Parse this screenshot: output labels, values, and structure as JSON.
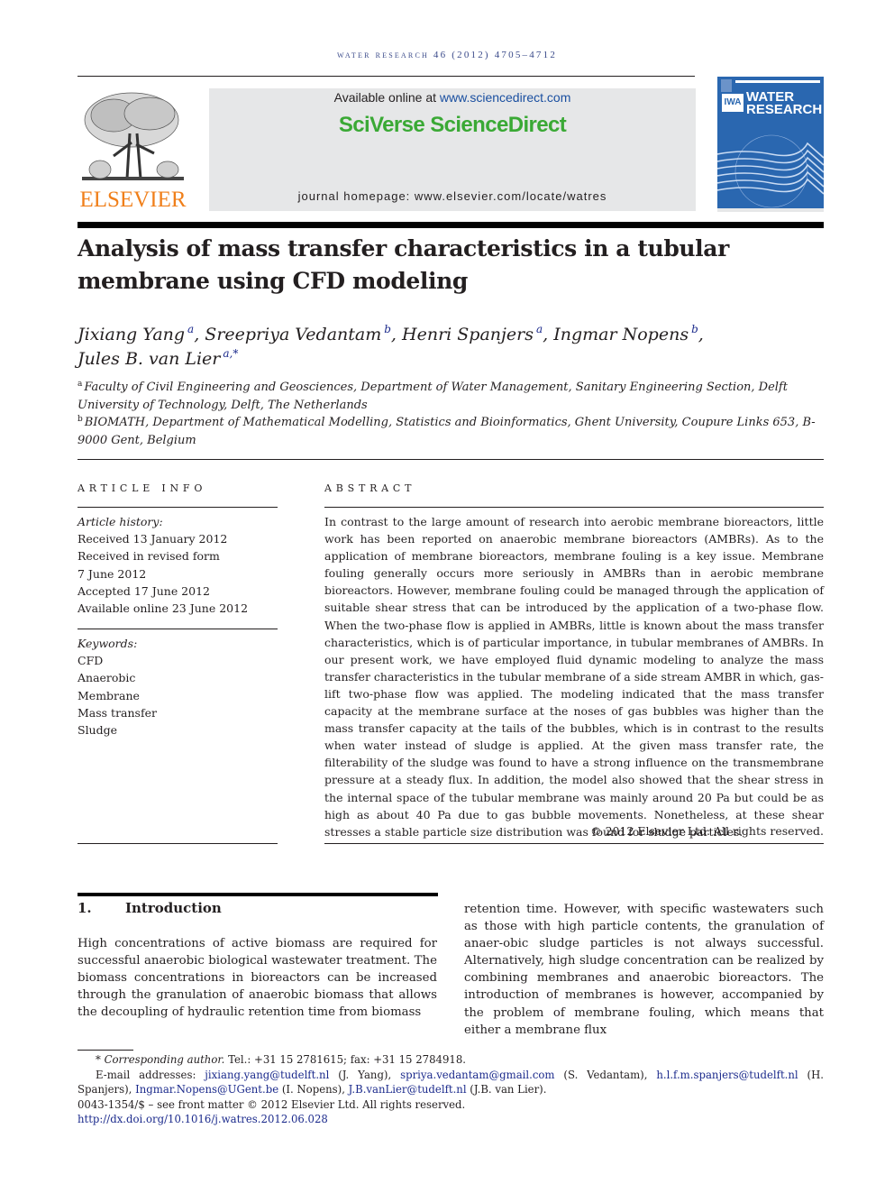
{
  "running_head": "WATER RESEARCH 46 (2012) 4705–4712",
  "header": {
    "publisher_name": "ELSEVIER",
    "available_online_prefix": "Available online at ",
    "available_online_link": "www.sciencedirect.com",
    "brand": "SciVerse ScienceDirect",
    "journal_homepage": "journal homepage: www.elsevier.com/locate/watres",
    "cover": {
      "badge": "IWA",
      "title_line1": "WATER",
      "title_line2": "RESEARCH",
      "color": "#2a67b0"
    }
  },
  "article": {
    "title": "Analysis of mass transfer characteristics in a tubular membrane using CFD modeling",
    "authors": [
      {
        "name": "Jixiang Yang",
        "sup": "a",
        "sep": ", "
      },
      {
        "name": "Sreepriya Vedantam",
        "sup": "b",
        "sep": ", "
      },
      {
        "name": "Henri Spanjers",
        "sup": "a",
        "sep": ", "
      },
      {
        "name": "Ingmar Nopens",
        "sup": "b",
        "sep": ","
      },
      {
        "name": "Jules B. van Lier",
        "sup": "a,*",
        "sep": ""
      }
    ],
    "affiliations": [
      {
        "mark": "a",
        "text": "Faculty of Civil Engineering and Geosciences, Department of Water Management, Sanitary Engineering Section, Delft University of Technology, Delft, The Netherlands"
      },
      {
        "mark": "b",
        "text": "BIOMATH, Department of Mathematical Modelling, Statistics and Bioinformatics, Ghent University, Coupure Links 653, B-9000 Gent, Belgium"
      }
    ]
  },
  "article_info": {
    "label": "ARTICLE INFO",
    "history_label": "Article history:",
    "history": [
      "Received 13 January 2012",
      "Received in revised form",
      "7 June 2012",
      "Accepted 17 June 2012",
      "Available online 23 June 2012"
    ],
    "keywords_label": "Keywords:",
    "keywords": [
      "CFD",
      "Anaerobic",
      "Membrane",
      "Mass transfer",
      "Sludge"
    ]
  },
  "abstract": {
    "label": "ABSTRACT",
    "text": "In contrast to the large amount of research into aerobic membrane bioreactors, little work has been reported on anaerobic membrane bioreactors (AMBRs). As to the application of membrane bioreactors, membrane fouling is a key issue. Membrane fouling generally occurs more seriously in AMBRs than in aerobic membrane bioreactors. However, membrane fouling could be managed through the application of suitable shear stress that can be introduced by the application of a two-phase flow. When the two-phase flow is applied in AMBRs, little is known about the mass transfer characteristics, which is of particular importance, in tubular membranes of AMBRs. In our present work, we have employed fluid dynamic modeling to analyze the mass transfer characteristics in the tubular membrane of a side stream AMBR in which, gas-lift two-phase flow was applied. The modeling indicated that the mass transfer capacity at the membrane surface at the noses of gas bubbles was higher than the mass transfer capacity at the tails of the bubbles, which is in contrast to the results when water instead of sludge is applied. At the given mass transfer rate, the filterability of the sludge was found to have a strong influence on the transmembrane pressure at a steady flux. In addition, the model also showed that the shear stress in the internal space of the tubular membrane was mainly around 20 Pa but could be as high as about 40 Pa due to gas bubble movements. Nonetheless, at these shear stresses a stable particle size distribution was found for sludge particles.",
    "copyright": "© 2012 Elsevier Ltd. All rights reserved."
  },
  "introduction": {
    "number": "1.",
    "heading": "Introduction",
    "left_column": "High concentrations of active biomass are required for successful anaerobic biological wastewater treatment. The biomass concentrations in bioreactors can be increased through the granulation of anaerobic biomass that allows the decoupling of hydraulic retention time from biomass",
    "right_column": "retention time. However, with specific wastewaters such as those with high particle contents, the granulation of anaer-obic sludge particles is not always successful. Alternatively, high sludge concentration can be realized by combining membranes and anaerobic bioreactors. The introduction of membranes is however, accompanied by the problem of membrane fouling, which means that either a membrane flux"
  },
  "footnotes": {
    "corresponding_mark": "*",
    "corresponding_label": "Corresponding author.",
    "corresponding_contact": " Tel.: +31 15 2781615; fax: +31 15 2784918.",
    "email_label": "E-mail addresses: ",
    "emails": [
      {
        "email": "jixiang.yang@tudelft.nl",
        "owner": " (J. Yang), "
      },
      {
        "email": "spriya.vedantam@gmail.com",
        "owner": " (S. Vedantam), "
      },
      {
        "email": "h.l.f.m.spanjers@tudelft.nl",
        "owner": " (H. Spanjers), "
      },
      {
        "email": "Ingmar.Nopens@UGent.be",
        "owner": " (I. Nopens), "
      },
      {
        "email": "J.B.vanLier@tudelft.nl",
        "owner": " (J.B. van Lier)."
      }
    ],
    "issn_line": "0043-1354/$ – see front matter © 2012 Elsevier Ltd. All rights reserved.",
    "doi": "http://dx.doi.org/10.1016/j.watres.2012.06.028"
  },
  "colors": {
    "link": "#1b2a8c",
    "brand_green": "#3aa935",
    "elsevier_orange": "#f07f1a"
  }
}
